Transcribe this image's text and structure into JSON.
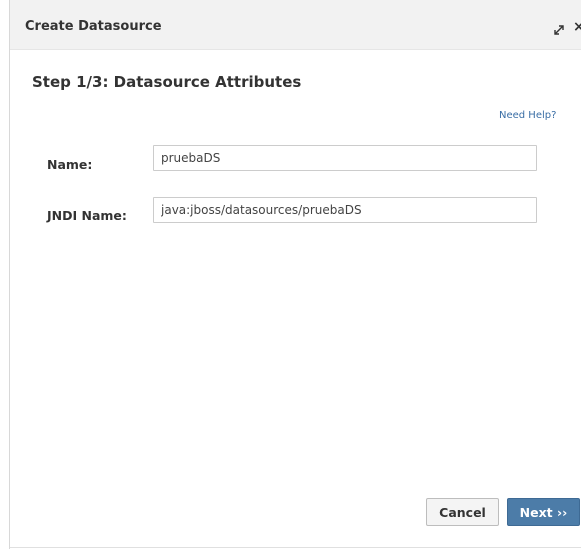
{
  "dialog": {
    "title": "Create Datasource",
    "icons": {
      "maximize": "maximize-icon",
      "close": "close-icon"
    },
    "close_glyph": "×"
  },
  "step": {
    "heading": "Step 1/3: Datasource Attributes"
  },
  "help": {
    "label": "Need Help?"
  },
  "form": {
    "name": {
      "label": "Name:",
      "value": "pruebaDS"
    },
    "jndi_name": {
      "label": "JNDI Name:",
      "value": "java:jboss/datasources/pruebaDS"
    }
  },
  "buttons": {
    "cancel": "Cancel",
    "next": "Next ››"
  },
  "colors": {
    "primary_button": "#4c7ca8",
    "link": "#3a6ea5",
    "titlebar": "#f2f2f2"
  }
}
